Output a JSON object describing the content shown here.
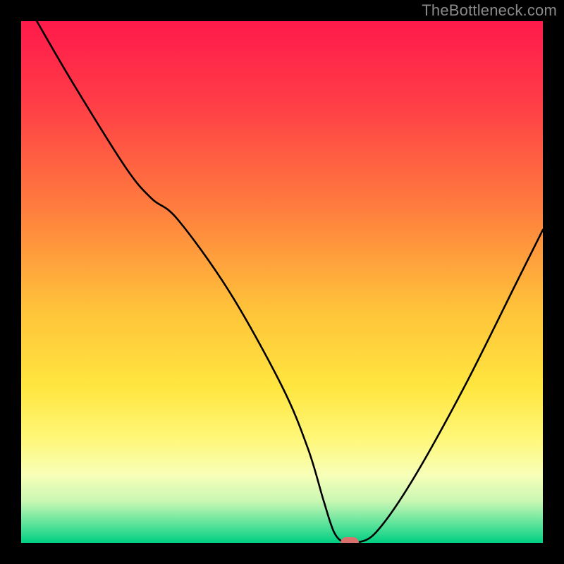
{
  "attribution": "TheBottleneck.com",
  "chart_data": {
    "type": "line",
    "title": "",
    "xlabel": "",
    "ylabel": "",
    "xlim": [
      0,
      100
    ],
    "ylim": [
      0,
      100
    ],
    "series": [
      {
        "name": "bottleneck-curve",
        "x": [
          3,
          10,
          20,
          25,
          30,
          40,
          50,
          55,
          58,
          60,
          62,
          64,
          68,
          75,
          85,
          95,
          100
        ],
        "y": [
          100,
          88,
          72,
          66,
          62,
          48,
          30,
          18,
          8,
          2,
          0,
          0,
          2,
          12,
          30,
          50,
          60
        ]
      }
    ],
    "marker": {
      "x": 63,
      "y": 0,
      "color": "#d9706c"
    },
    "gradient_stops": [
      {
        "pct": 0,
        "color": "#ff1a4b"
      },
      {
        "pct": 15,
        "color": "#ff3b47"
      },
      {
        "pct": 35,
        "color": "#ff7a3e"
      },
      {
        "pct": 55,
        "color": "#ffc23a"
      },
      {
        "pct": 70,
        "color": "#ffe63f"
      },
      {
        "pct": 80,
        "color": "#fff778"
      },
      {
        "pct": 87,
        "color": "#f7ffb8"
      },
      {
        "pct": 92,
        "color": "#c9f7b3"
      },
      {
        "pct": 96,
        "color": "#66e59d"
      },
      {
        "pct": 100,
        "color": "#00cf82"
      }
    ]
  }
}
